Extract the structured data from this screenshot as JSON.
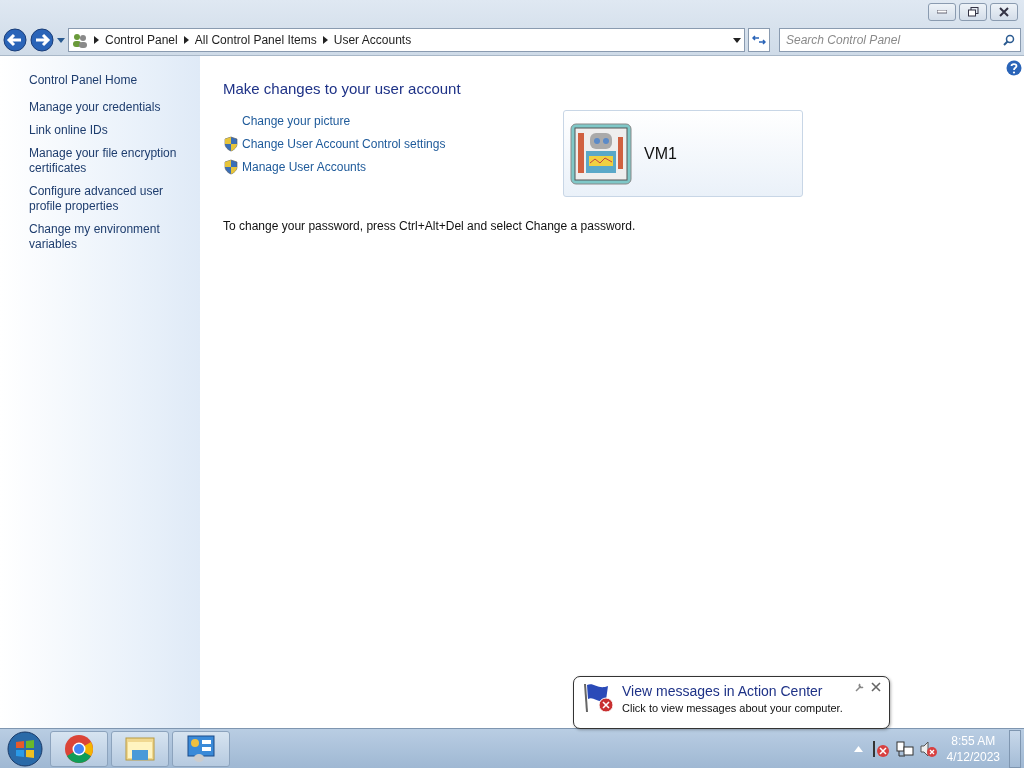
{
  "address_bar": {
    "breadcrumb": [
      "Control Panel",
      "All Control Panel Items",
      "User Accounts"
    ]
  },
  "search": {
    "placeholder": "Search Control Panel"
  },
  "sidebar": {
    "home": "Control Panel Home",
    "tasks": [
      "Manage your credentials",
      "Link online IDs",
      "Manage your file encryption certificates",
      "Configure advanced user profile properties",
      "Change my environment variables"
    ]
  },
  "main": {
    "heading": "Make changes to your user account",
    "links": [
      {
        "label": "Change your picture",
        "kind": "plain"
      },
      {
        "label": "Change User Account Control settings",
        "kind": "shield"
      },
      {
        "label": "Manage User Accounts",
        "kind": "shield"
      }
    ],
    "account": {
      "name": "VM1"
    },
    "note": "To change your password, press Ctrl+Alt+Del and select Change a password."
  },
  "notification": {
    "title": "View messages in Action Center",
    "text": "Click to view messages about your computer."
  },
  "taskbar": {
    "apps": [
      {
        "kind": "browser"
      },
      {
        "kind": "explorer"
      },
      {
        "kind": "control-panel"
      }
    ],
    "time": "8:55 AM",
    "date": "4/12/2023"
  }
}
